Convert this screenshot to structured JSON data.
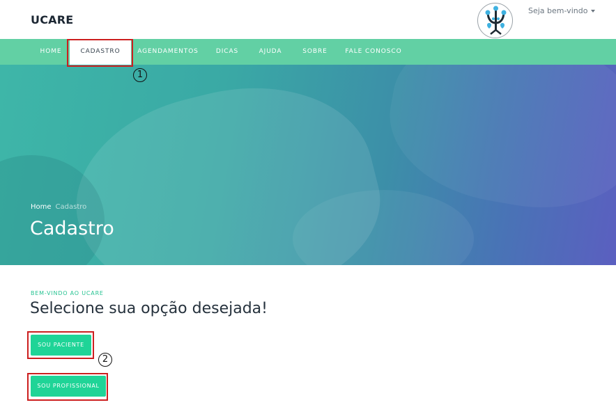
{
  "header": {
    "brand": "UCARE",
    "user_menu": "Seja bem-vindo"
  },
  "nav": {
    "items": [
      {
        "label": "HOME",
        "active": false
      },
      {
        "label": "CADASTRO",
        "active": true
      },
      {
        "label": "AGENDAMENTOS",
        "active": false
      },
      {
        "label": "DICAS",
        "active": false
      },
      {
        "label": "AJUDA",
        "active": false
      },
      {
        "label": "SOBRE",
        "active": false
      },
      {
        "label": "FALE CONOSCO",
        "active": false
      }
    ]
  },
  "hero": {
    "breadcrumb": {
      "home": "Home",
      "current": "Cadastro"
    },
    "title": "Cadastro"
  },
  "main": {
    "subheading": "BEM-VINDO AO UCARE",
    "title": "Selecione sua opção desejada!",
    "buttons": {
      "patient": "SOU PACIENTE",
      "professional": "SOU PROFISSIONAL"
    }
  },
  "annotations": {
    "marker1": "1",
    "marker2": "2"
  },
  "colors": {
    "nav_bg": "#62d0a4",
    "accent": "#1fd497",
    "highlight": "#cc1f1f"
  }
}
